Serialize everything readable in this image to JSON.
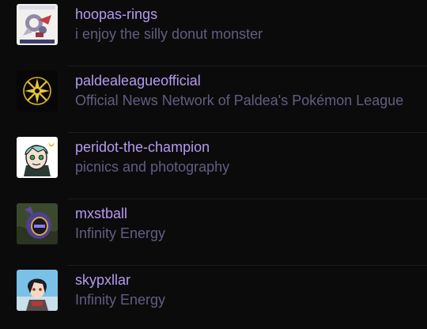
{
  "theme": {
    "accent": "#b69af0",
    "muted": "#645d80"
  },
  "blogs": [
    {
      "name": "hoopas-rings",
      "description": "i enjoy the silly donut monster",
      "avatar": "hoopa-avatar-icon"
    },
    {
      "name": "paldealeagueofficial",
      "description": "Official News Network of Paldea's Pokémon League",
      "avatar": "league-star-avatar-icon"
    },
    {
      "name": "peridot-the-champion",
      "description": "picnics and photography",
      "avatar": "peridot-avatar-icon"
    },
    {
      "name": "mxstball",
      "description": "Infinity Energy",
      "avatar": "masked-knight-avatar-icon"
    },
    {
      "name": "skypxllar",
      "description": "Infinity Energy",
      "avatar": "anime-girl-avatar-icon"
    }
  ]
}
